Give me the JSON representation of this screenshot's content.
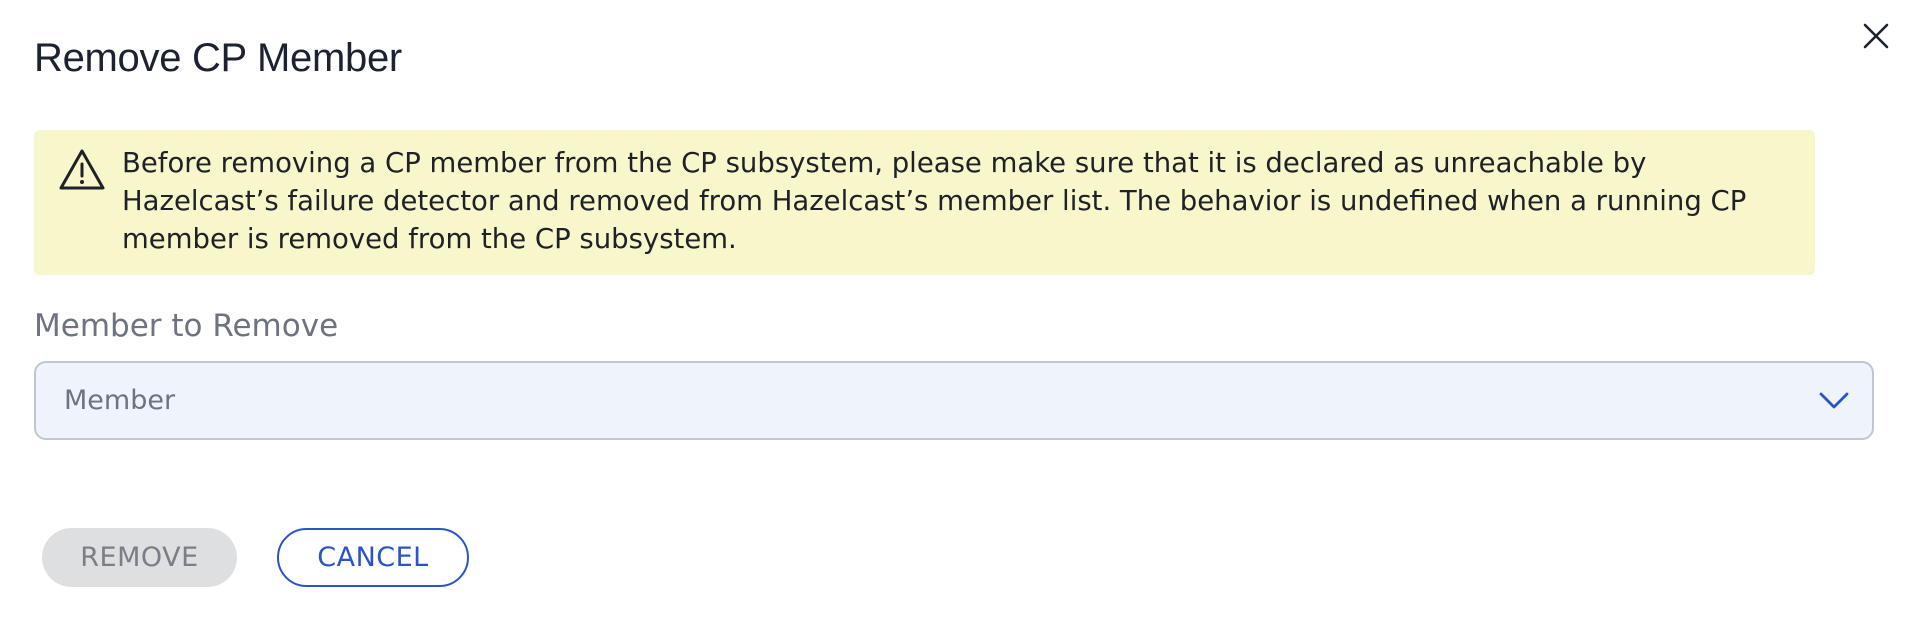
{
  "dialog": {
    "title": "Remove CP Member",
    "close_icon": "close-icon"
  },
  "alert": {
    "icon": "warning-icon",
    "text": "Before removing a CP member from the CP subsystem, please make sure that it is declared as unreachable by Hazelcast’s failure detector and removed from Hazelcast’s member list. The behavior is undefined when a running CP member is removed from the CP subsystem.",
    "background_color": "#f8f6cb"
  },
  "member_field": {
    "label": "Member to Remove",
    "placeholder": "Member",
    "chevron_icon": "chevron-down-icon"
  },
  "actions": {
    "remove_label": "REMOVE",
    "cancel_label": "CANCEL",
    "remove_disabled": true,
    "accent_color": "#2a55c8"
  }
}
